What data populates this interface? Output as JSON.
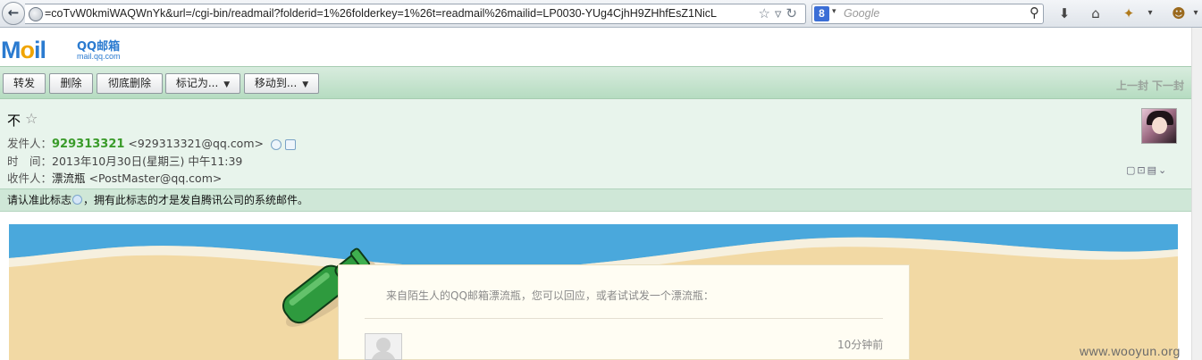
{
  "browser": {
    "url": "=coTvW0kmiWAQWnYk&url=/cgi-bin/readmail?folderid=1%26folderkey=1%26t=readmail%26mailid=LP0030-YUg4CjhH9ZHhfEsZ1NicL",
    "search_placeholder": "Google",
    "search_engine_glyph": "8"
  },
  "mail_header": {
    "logo_text": "M",
    "logo_dot": "o",
    "logo_tail": "il",
    "brand": "QQ邮箱",
    "domain": "mail.qq.com"
  },
  "toolbar": {
    "forward": "转发",
    "delete": "删除",
    "delete_permanently": "彻底删除",
    "mark_as": "标记为...",
    "move_to": "移动到...",
    "prev_mail": "上一封",
    "next_mail": "下一封"
  },
  "message": {
    "subject": "不",
    "sender_label": "发件人：",
    "sender_name": "929313321",
    "sender_email": "<929313321@qq.com>",
    "time_label": "时　间：",
    "time_value": "2013年10月30日(星期三) 中午11:39",
    "recipient_label": "收件人：",
    "recipient_name": "漂流瓶",
    "recipient_email": "<PostMaster@qq.com>"
  },
  "verify": {
    "prefix": "请认准此标志",
    "suffix": "，拥有此标志的才是发自腾讯公司的系统邮件。"
  },
  "body": {
    "card_text": "来自陌生人的QQ邮箱漂流瓶，您可以回应，或者试试发一个漂流瓶：",
    "reply_time": "10分钟前"
  },
  "watermark": "www.wooyun.org",
  "colors": {
    "sky": "#4aa8dc",
    "sand": "#f2d9a4",
    "bottle": "#2e9a3e",
    "sender_green": "#3a9b2a"
  }
}
